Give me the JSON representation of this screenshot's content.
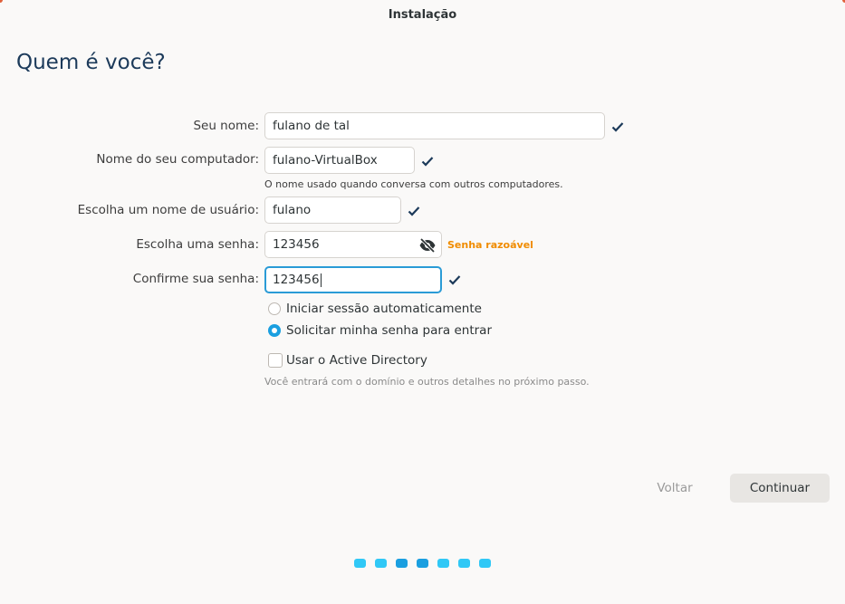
{
  "window": {
    "title": "Instalação"
  },
  "page": {
    "heading": "Quem é você?"
  },
  "form": {
    "name": {
      "label": "Seu nome:",
      "value": "fulano de tal",
      "valid": true
    },
    "computer": {
      "label": "Nome do seu computador:",
      "value": "fulano-VirtualBox",
      "hint": "O nome usado quando conversa com outros computadores.",
      "valid": true
    },
    "username": {
      "label": "Escolha um nome de usuário:",
      "value": "fulano",
      "valid": true
    },
    "password": {
      "label": "Escolha uma senha:",
      "value": "123456",
      "strength": "Senha razoável",
      "strength_color": "#f08c00"
    },
    "confirm": {
      "label": "Confirme sua senha:",
      "value": "123456",
      "valid": true
    },
    "login_options": [
      {
        "label": "Iniciar sessão automaticamente",
        "selected": false
      },
      {
        "label": "Solicitar minha senha para entrar",
        "selected": true
      }
    ],
    "active_directory": {
      "label": "Usar o Active Directory",
      "checked": false,
      "hint": "Você entrará com o domínio e outros detalhes no próximo passo."
    }
  },
  "buttons": {
    "back": "Voltar",
    "continue": "Continuar"
  },
  "progress": {
    "total_steps": 7,
    "current_step": 4
  },
  "colors": {
    "accent": "#1a9fe0",
    "heading": "#1c3a5a",
    "check": "#1c3a5a",
    "progress_light": "#30c8f6"
  }
}
